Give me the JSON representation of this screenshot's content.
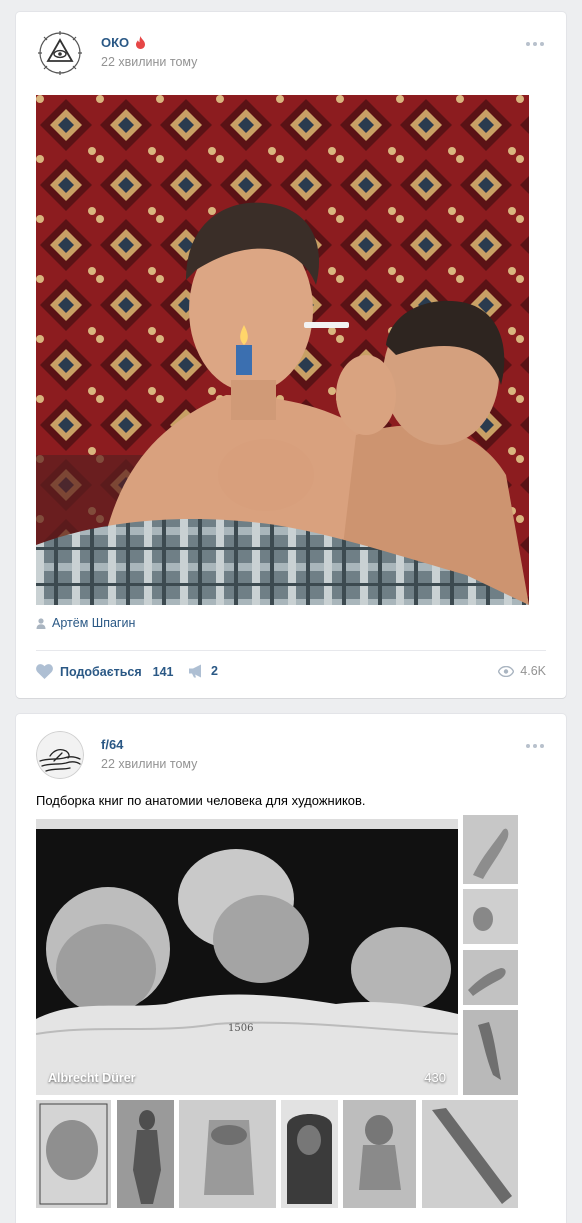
{
  "posts": [
    {
      "author": "ОКО",
      "time": "22 хвилини тому",
      "signer": "Артём Шпагин",
      "like_label": "Подобається",
      "likes": "141",
      "shares": "2",
      "views": "4.6K",
      "icons": [
        "fire-icon",
        "more-icon",
        "person-icon",
        "heart-icon",
        "megaphone-icon",
        "eye-icon"
      ]
    },
    {
      "author": "f/64",
      "time": "22 хвилини тому",
      "text": "Подборка книг по анатомии человека для художников.",
      "album_title": "Albrecht Dürer",
      "album_count": "430"
    }
  ],
  "colors": {
    "background": "#edeef0",
    "link": "#2a5885",
    "secondary": "#939393",
    "card": "#ffffff"
  }
}
